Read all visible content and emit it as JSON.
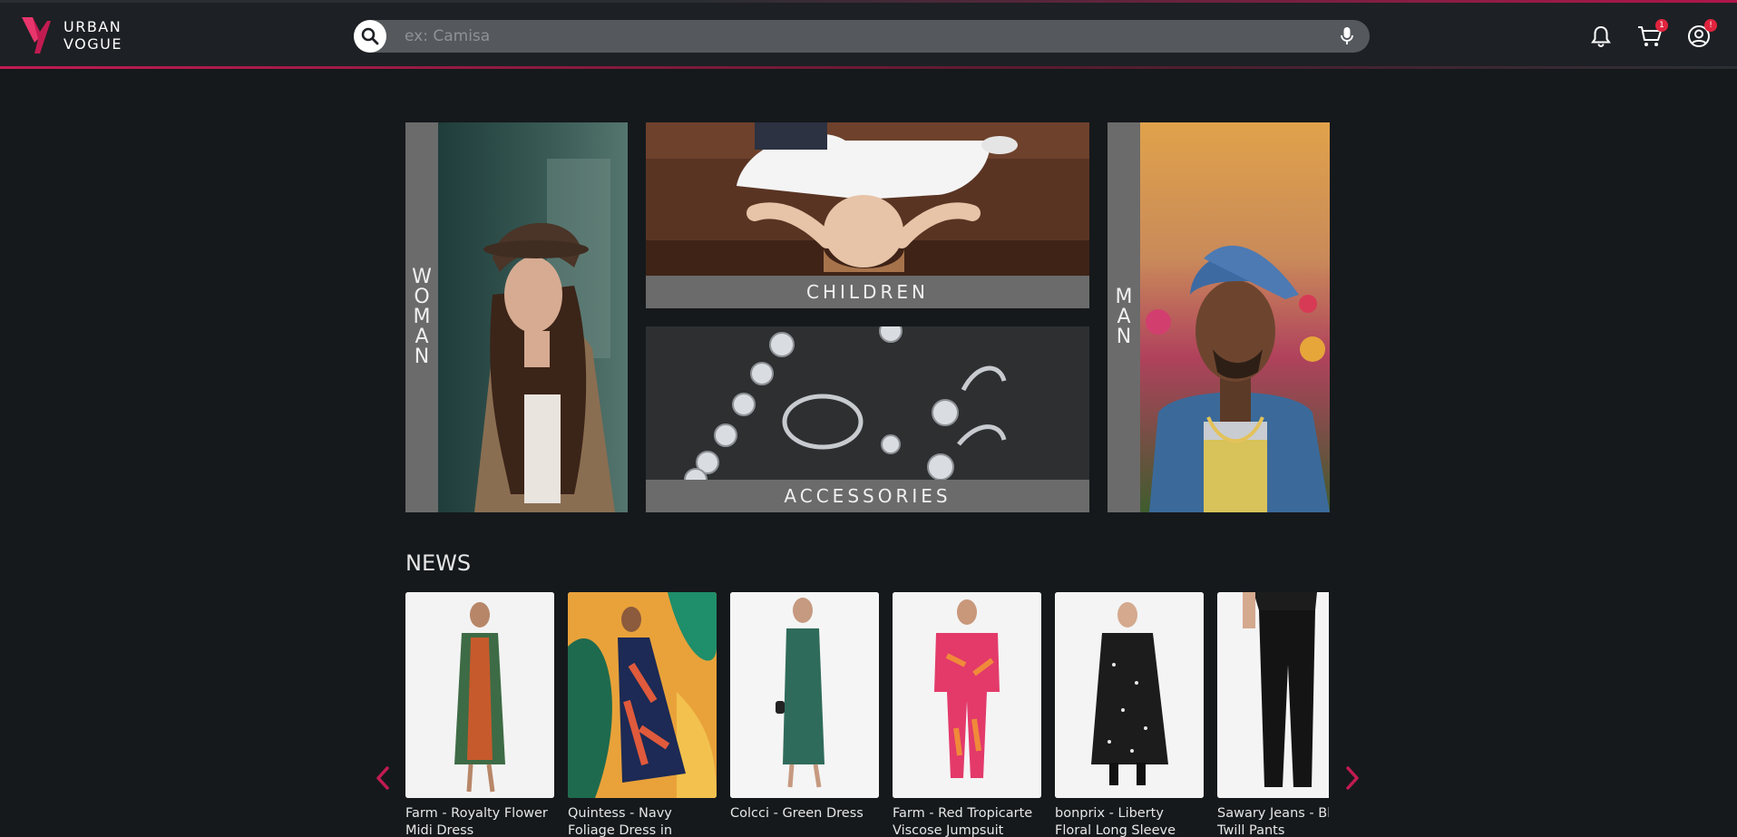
{
  "header": {
    "logo_line1": "URBAN",
    "logo_line2": "VOGUE",
    "search_placeholder": "ex: Camisa",
    "cart_badge": "1",
    "account_badge": "!"
  },
  "categories": {
    "woman": [
      "W",
      "O",
      "M",
      "A",
      "N"
    ],
    "man": [
      "M",
      "A",
      "N"
    ],
    "children": "CHILDREN",
    "accessories": "ACCESSORIES"
  },
  "news": {
    "title": "NEWS",
    "products": [
      {
        "name": "Farm - Royalty Flower Midi Dress"
      },
      {
        "name": "Quintess - Navy Foliage Dress in"
      },
      {
        "name": "Colcci - Green Dress"
      },
      {
        "name": "Farm - Red Tropicarte Viscose Jumpsuit"
      },
      {
        "name": "bonprix - Liberty Floral Long Sleeve Dress"
      },
      {
        "name": "Sawary Jeans - Black Twill Pants"
      }
    ]
  },
  "colors": {
    "accent": "#c21b52",
    "background": "#15191c",
    "label_strip": "#6b6b6b"
  },
  "icons": {
    "search": "search-icon",
    "mic": "microphone-icon",
    "bell": "bell-icon",
    "cart": "cart-icon",
    "account": "account-icon",
    "prev": "chevron-left-icon",
    "next": "chevron-right-icon"
  }
}
